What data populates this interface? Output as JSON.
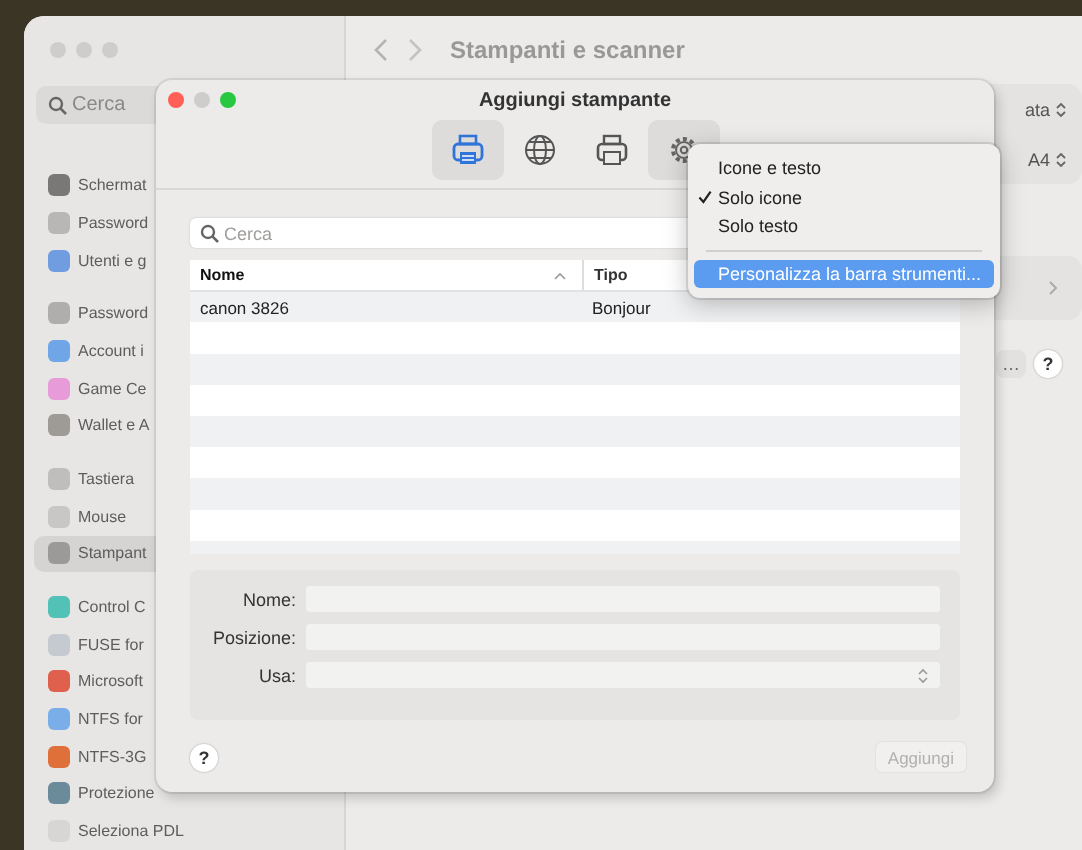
{
  "background_window": {
    "title": "Stampanti e scanner",
    "search": {
      "placeholder": "Cerca"
    },
    "sidebar": {
      "groups": [
        [
          {
            "label": "Schermat",
            "selected": false
          },
          {
            "label": "Password",
            "selected": false
          },
          {
            "label": "Utenti e g",
            "selected": false
          }
        ],
        [
          {
            "label": "Password",
            "selected": false
          },
          {
            "label": "Account i",
            "selected": false
          },
          {
            "label": "Game Ce",
            "selected": false
          },
          {
            "label": "Wallet e A",
            "selected": false
          }
        ],
        [
          {
            "label": "Tastiera",
            "selected": false
          },
          {
            "label": "Mouse",
            "selected": false
          },
          {
            "label": "Stampant",
            "selected": true
          }
        ],
        [
          {
            "label": "Control C",
            "selected": false
          },
          {
            "label": "FUSE for",
            "selected": false
          },
          {
            "label": "Microsoft",
            "selected": false
          },
          {
            "label": "NTFS for",
            "selected": false
          },
          {
            "label": "NTFS-3G",
            "selected": false
          },
          {
            "label": "Protezione",
            "selected": false
          },
          {
            "label": "Seleziona PDL",
            "selected": false
          }
        ]
      ]
    },
    "settings": {
      "popups": [
        "ata",
        "A4"
      ],
      "queue_button": "…",
      "help": "?"
    }
  },
  "dialog": {
    "title": "Aggiungi stampante",
    "toolbar": [
      {
        "kind": "printer",
        "selected": true
      },
      {
        "kind": "globe",
        "selected": false
      },
      {
        "kind": "windows-printer",
        "selected": false
      },
      {
        "kind": "gear",
        "selected": false,
        "open": true
      }
    ],
    "search": {
      "placeholder": "Cerca"
    },
    "table": {
      "columns": [
        {
          "label": "Nome",
          "sorted": true
        },
        {
          "label": "Tipo",
          "sorted": false
        }
      ],
      "rows": [
        [
          "canon 3826",
          "Bonjour"
        ]
      ]
    },
    "form": [
      {
        "label": "Nome:",
        "kind": "text"
      },
      {
        "label": "Posizione:",
        "kind": "text"
      },
      {
        "label": "Usa:",
        "kind": "popup"
      }
    ],
    "help": "?",
    "add_button": {
      "label": "Aggiungi",
      "disabled": true
    }
  },
  "menu": {
    "items": [
      {
        "kind": "item",
        "label": "Icone e testo",
        "checked": false,
        "selected": false
      },
      {
        "kind": "item",
        "label": "Solo icone",
        "checked": true,
        "selected": false
      },
      {
        "kind": "item",
        "label": "Solo testo",
        "checked": false,
        "selected": false
      },
      {
        "kind": "separator"
      },
      {
        "kind": "item",
        "label": "Personalizza la barra strumenti...",
        "checked": false,
        "selected": true
      }
    ]
  }
}
